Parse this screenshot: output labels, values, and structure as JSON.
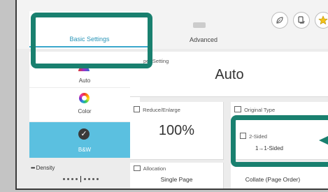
{
  "tabs": {
    "basic_label": "Basic Settings",
    "advanced_label": "Advanced"
  },
  "header_icons": [
    "eco-leaf-icon",
    "hand-document-icon",
    "star-icon"
  ],
  "left_buttons": {
    "auto_label": "Auto",
    "color_label": "Color",
    "bw_label": "B&W",
    "selected": "B&W"
  },
  "density": {
    "label": "Density",
    "level": 4,
    "level_count": 9
  },
  "paper_setting": {
    "title": "Paper Setting",
    "title_visible": "per Setting",
    "value": "Auto"
  },
  "reduce_enlarge": {
    "title": "Reduce/Enlarge",
    "value": "100%"
  },
  "original_type": {
    "title": "Original Type"
  },
  "two_sided": {
    "title": "2-Sided",
    "value": "1→1-Sided"
  },
  "allocation": {
    "title": "Allocation",
    "value": "Single Page"
  },
  "collate": {
    "value": "Collate (Page Order)"
  },
  "colors": {
    "accent": "#3aa7cc",
    "selected_bg": "#5bc0e0",
    "highlight": "#19806f"
  }
}
